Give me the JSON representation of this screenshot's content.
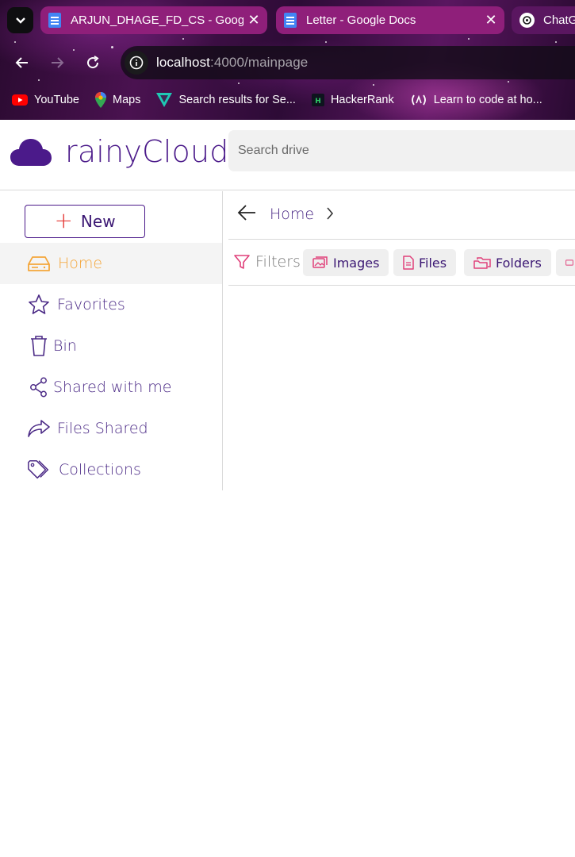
{
  "browser": {
    "tabs": [
      {
        "title": "ARJUN_DHAGE_FD_CS - Google",
        "close": "✕"
      },
      {
        "title": "Letter - Google Docs",
        "close": "✕"
      },
      {
        "title": "ChatG"
      }
    ],
    "url_host": "localhost",
    "url_path": ":4000/mainpage",
    "bookmarks": [
      {
        "label": "YouTube"
      },
      {
        "label": "Maps"
      },
      {
        "label": "Search results for Se..."
      },
      {
        "label": "HackerRank"
      },
      {
        "label": "Learn to code at ho..."
      }
    ]
  },
  "app": {
    "brand": "rainyCloud",
    "search_placeholder": "Search drive",
    "new_button": {
      "plus": "+",
      "label": "New"
    },
    "nav": [
      {
        "label": "Home",
        "icon": "drive-icon",
        "active": true
      },
      {
        "label": "Favorites",
        "icon": "star-icon"
      },
      {
        "label": "Bin",
        "icon": "trash-icon"
      },
      {
        "label": "Shared with me",
        "icon": "share-icon"
      },
      {
        "label": "Files Shared",
        "icon": "forward-icon"
      },
      {
        "label": "Collections",
        "icon": "tag-icon"
      }
    ],
    "breadcrumb": {
      "home": "Home"
    },
    "filters": {
      "label": "Filters",
      "chips": [
        {
          "label": "Images",
          "icon": "images-icon"
        },
        {
          "label": "Files",
          "icon": "file-icon"
        },
        {
          "label": "Folders",
          "icon": "folders-icon"
        }
      ]
    }
  },
  "colors": {
    "brand": "#4b1a8a",
    "active_nav": "#f4a63a",
    "chip_icon": "#e0407a"
  }
}
